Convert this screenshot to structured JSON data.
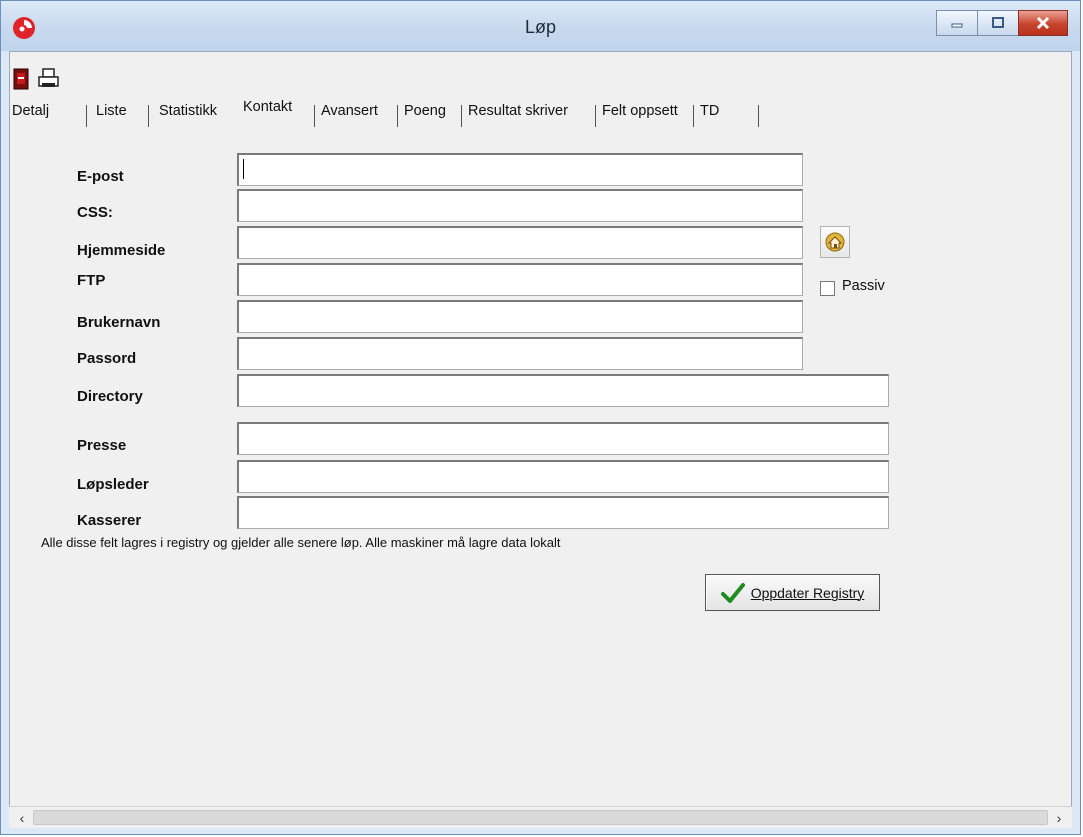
{
  "window": {
    "title": "Løp"
  },
  "tabs": [
    {
      "label": "Detalj"
    },
    {
      "label": "Liste"
    },
    {
      "label": "Statistikk"
    },
    {
      "label": "Kontakt"
    },
    {
      "label": "Avansert"
    },
    {
      "label": "Poeng"
    },
    {
      "label": "Resultat skriver"
    },
    {
      "label": "Felt oppsett"
    },
    {
      "label": "TD"
    }
  ],
  "active_tab": "Kontakt",
  "form": {
    "epost": {
      "label": "E-post",
      "value": ""
    },
    "css": {
      "label": "CSS:",
      "value": ""
    },
    "hjemmeside": {
      "label": "Hjemmeside",
      "value": ""
    },
    "ftp": {
      "label": "FTP",
      "value": ""
    },
    "brukernavn": {
      "label": "Brukernavn",
      "value": ""
    },
    "passord": {
      "label": "Passord",
      "value": ""
    },
    "directory": {
      "label": "Directory",
      "value": ""
    },
    "presse": {
      "label": "Presse",
      "value": ""
    },
    "lopsleder": {
      "label": "Løpsleder",
      "value": ""
    },
    "kasserer": {
      "label": "Kasserer",
      "value": ""
    },
    "passiv": {
      "label": "Passiv",
      "checked": false
    }
  },
  "note": "Alle disse felt lagres i registry og gjelder alle senere løp. Alle maskiner må lagre data lokalt",
  "update_button": {
    "label": "Oppdater Registry"
  },
  "icons": {
    "app": "app-logo-icon",
    "door": "exit-door-icon",
    "printer": "printer-icon",
    "home": "home-icon",
    "check": "checkmark-icon"
  },
  "colors": {
    "title_bar": "#c7d9ee",
    "close_button": "#c7442d",
    "check_green": "#1f8a1f"
  }
}
